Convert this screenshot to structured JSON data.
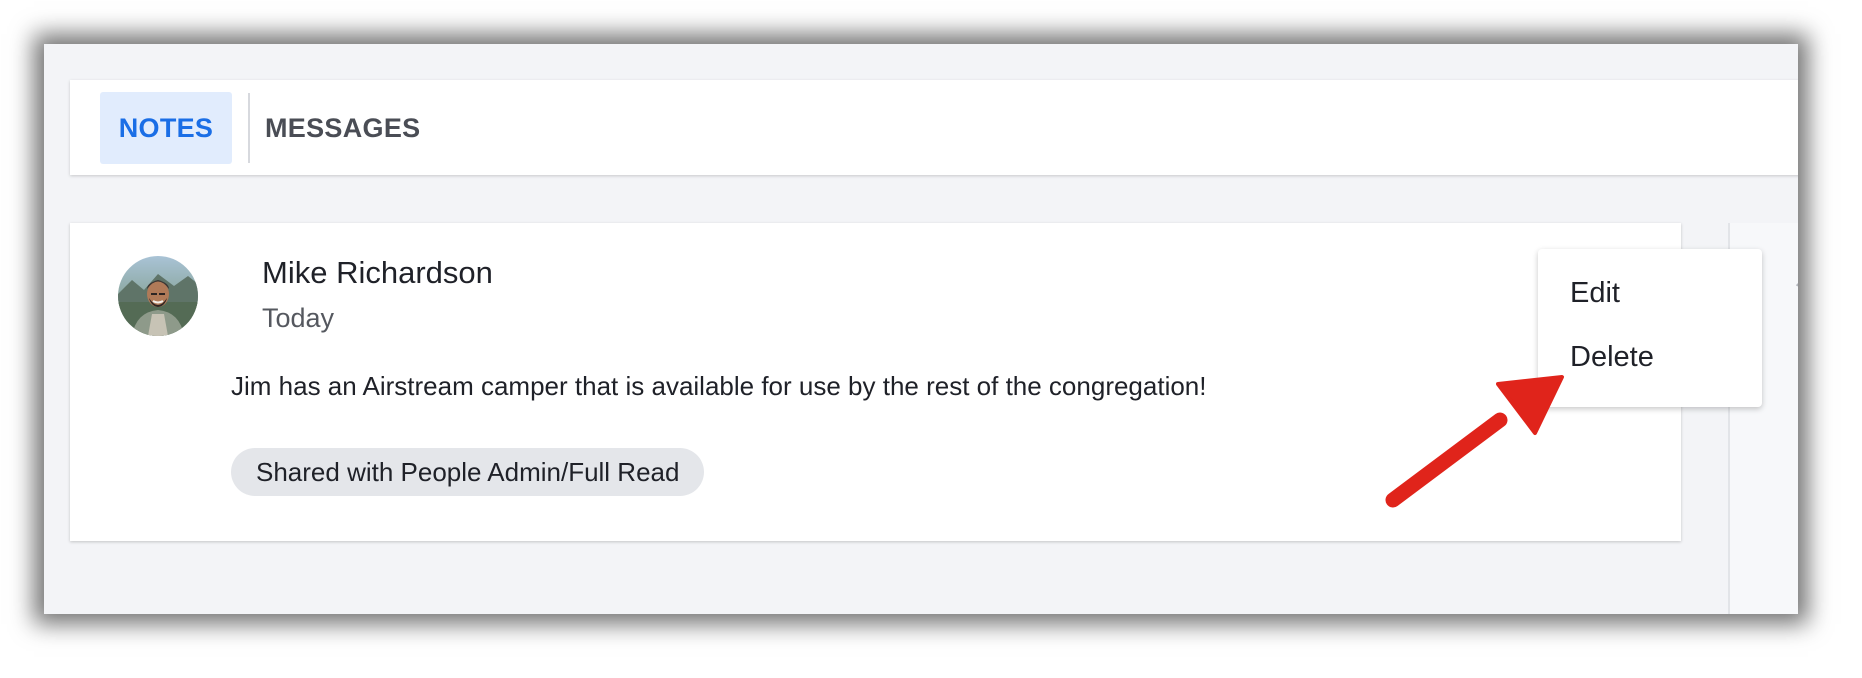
{
  "tabs": {
    "notes": "NOTES",
    "messages": "MESSAGES"
  },
  "note": {
    "author": "Mike Richardson",
    "date": "Today",
    "text": "Jim has an Airstream camper that is available for use by the rest of the congregation!",
    "shared_badge": "Shared with People Admin/Full Read"
  },
  "menu": {
    "edit": "Edit",
    "delete": "Delete"
  },
  "colors": {
    "active_tab_text": "#1a6ee6",
    "active_tab_bg": "#e1ecfd",
    "annotation_arrow": "#e0241b"
  }
}
